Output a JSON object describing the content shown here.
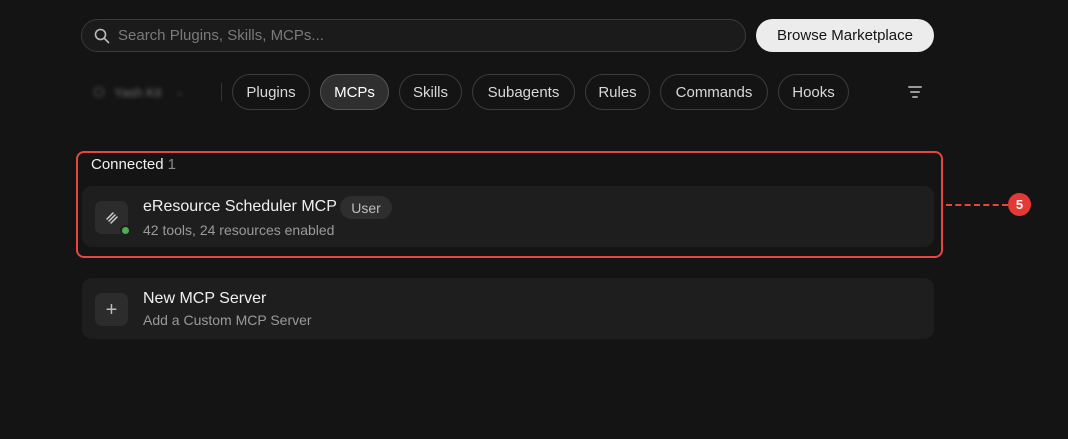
{
  "search": {
    "placeholder": "Search Plugins, Skills, MCPs..."
  },
  "header": {
    "browse_label": "Browse  Marketplace"
  },
  "user_filter": {
    "label": "Yash Kit"
  },
  "tabs": [
    {
      "label": "Plugins",
      "active": false
    },
    {
      "label": "MCPs",
      "active": true
    },
    {
      "label": "Skills",
      "active": false
    },
    {
      "label": "Subagents",
      "active": false
    },
    {
      "label": "Rules",
      "active": false
    },
    {
      "label": "Commands",
      "active": false
    },
    {
      "label": "Hooks",
      "active": false
    }
  ],
  "connected": {
    "title": "Connected",
    "count": "1",
    "items": [
      {
        "name": "eResource Scheduler MCP",
        "badge": "User",
        "subtitle": "42 tools, 24 resources enabled",
        "status_color": "#4caf50"
      }
    ]
  },
  "new_server": {
    "title": "New MCP Server",
    "subtitle": "Add a Custom MCP Server"
  },
  "annotation": {
    "number": "5",
    "color": "#e5473f"
  }
}
